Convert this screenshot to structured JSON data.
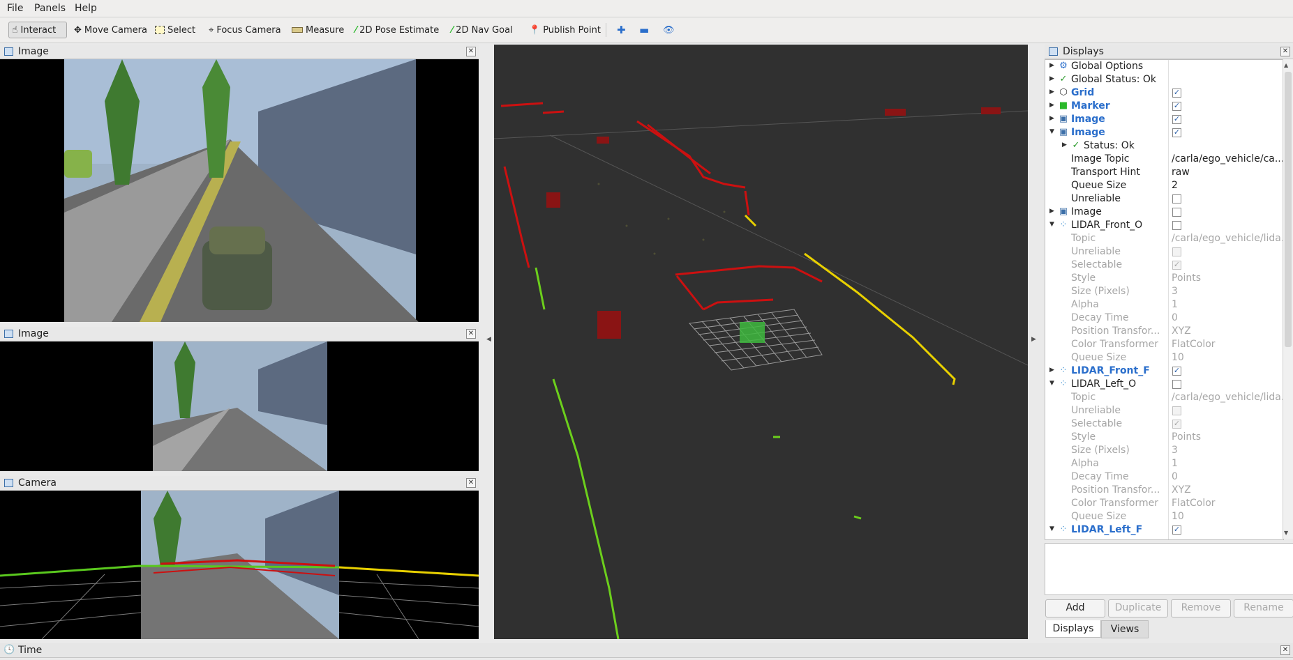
{
  "menu": {
    "file": "File",
    "panels": "Panels",
    "help": "Help"
  },
  "toolbar": {
    "interact": "Interact",
    "move_camera": "Move Camera",
    "select": "Select",
    "focus_camera": "Focus Camera",
    "measure": "Measure",
    "pose_estimate": "2D Pose Estimate",
    "nav_goal": "2D Nav Goal",
    "publish_point": "Publish Point"
  },
  "panels": {
    "image1_title": "Image",
    "image2_title": "Image",
    "camera_title": "Camera",
    "displays_title": "Displays",
    "time_title": "Time"
  },
  "tree": [
    {
      "arrow": "right",
      "icon": "globe-icon",
      "name": "Global Options",
      "value": "",
      "check": null,
      "level": 0,
      "style": "normal"
    },
    {
      "arrow": "right",
      "icon": "check-icon",
      "name": "Global Status: Ok",
      "value": "",
      "check": null,
      "level": 0,
      "style": "normal"
    },
    {
      "arrow": "right",
      "icon": "grid-icon",
      "name": "Grid",
      "value": "",
      "check": true,
      "level": 0,
      "style": "blue"
    },
    {
      "arrow": "right",
      "icon": "cube-icon",
      "name": "Marker",
      "value": "",
      "check": true,
      "level": 0,
      "style": "blue"
    },
    {
      "arrow": "right",
      "icon": "image-icon",
      "name": "Image",
      "value": "",
      "check": true,
      "level": 0,
      "style": "blue"
    },
    {
      "arrow": "down",
      "icon": "image-icon",
      "name": "Image",
      "value": "",
      "check": true,
      "level": 0,
      "style": "blue"
    },
    {
      "arrow": "right",
      "icon": "check-icon",
      "name": "Status: Ok",
      "value": "",
      "check": null,
      "level": 1,
      "style": "normal"
    },
    {
      "arrow": "",
      "icon": "",
      "name": "Image Topic",
      "value": "/carla/ego_vehicle/ca...",
      "check": null,
      "level": 1,
      "style": "normal"
    },
    {
      "arrow": "",
      "icon": "",
      "name": "Transport Hint",
      "value": "raw",
      "check": null,
      "level": 1,
      "style": "normal"
    },
    {
      "arrow": "",
      "icon": "",
      "name": "Queue Size",
      "value": "2",
      "check": null,
      "level": 1,
      "style": "normal"
    },
    {
      "arrow": "",
      "icon": "",
      "name": "Unreliable",
      "value": "",
      "check": false,
      "level": 1,
      "style": "normal"
    },
    {
      "arrow": "right",
      "icon": "image-icon",
      "name": "Image",
      "value": "",
      "check": false,
      "level": 0,
      "style": "normal"
    },
    {
      "arrow": "down",
      "icon": "pointcloud-icon",
      "name": "LIDAR_Front_O",
      "value": "",
      "check": false,
      "level": 0,
      "style": "normal"
    },
    {
      "arrow": "",
      "icon": "",
      "name": "Topic",
      "value": "/carla/ego_vehicle/lida...",
      "check": null,
      "level": 1,
      "style": "dis"
    },
    {
      "arrow": "",
      "icon": "",
      "name": "Unreliable",
      "value": "",
      "check": false,
      "level": 1,
      "style": "dis"
    },
    {
      "arrow": "",
      "icon": "",
      "name": "Selectable",
      "value": "",
      "check": true,
      "level": 1,
      "style": "dis"
    },
    {
      "arrow": "",
      "icon": "",
      "name": "Style",
      "value": "Points",
      "check": null,
      "level": 1,
      "style": "dis"
    },
    {
      "arrow": "",
      "icon": "",
      "name": "Size (Pixels)",
      "value": "3",
      "check": null,
      "level": 1,
      "style": "dis"
    },
    {
      "arrow": "",
      "icon": "",
      "name": "Alpha",
      "value": "1",
      "check": null,
      "level": 1,
      "style": "dis"
    },
    {
      "arrow": "",
      "icon": "",
      "name": "Decay Time",
      "value": "0",
      "check": null,
      "level": 1,
      "style": "dis"
    },
    {
      "arrow": "",
      "icon": "",
      "name": "Position Transfor...",
      "value": "XYZ",
      "check": null,
      "level": 1,
      "style": "dis"
    },
    {
      "arrow": "",
      "icon": "",
      "name": "Color Transformer",
      "value": "FlatColor",
      "check": null,
      "level": 1,
      "style": "dis"
    },
    {
      "arrow": "",
      "icon": "",
      "name": "Queue Size",
      "value": "10",
      "check": null,
      "level": 1,
      "style": "dis"
    },
    {
      "arrow": "right",
      "icon": "pointcloud-icon",
      "name": "LIDAR_Front_F",
      "value": "",
      "check": true,
      "level": 0,
      "style": "blue"
    },
    {
      "arrow": "down",
      "icon": "pointcloud-icon",
      "name": "LIDAR_Left_O",
      "value": "",
      "check": false,
      "level": 0,
      "style": "normal"
    },
    {
      "arrow": "",
      "icon": "",
      "name": "Topic",
      "value": "/carla/ego_vehicle/lida...",
      "check": null,
      "level": 1,
      "style": "dis"
    },
    {
      "arrow": "",
      "icon": "",
      "name": "Unreliable",
      "value": "",
      "check": false,
      "level": 1,
      "style": "dis"
    },
    {
      "arrow": "",
      "icon": "",
      "name": "Selectable",
      "value": "",
      "check": true,
      "level": 1,
      "style": "dis"
    },
    {
      "arrow": "",
      "icon": "",
      "name": "Style",
      "value": "Points",
      "check": null,
      "level": 1,
      "style": "dis"
    },
    {
      "arrow": "",
      "icon": "",
      "name": "Size (Pixels)",
      "value": "3",
      "check": null,
      "level": 1,
      "style": "dis"
    },
    {
      "arrow": "",
      "icon": "",
      "name": "Alpha",
      "value": "1",
      "check": null,
      "level": 1,
      "style": "dis"
    },
    {
      "arrow": "",
      "icon": "",
      "name": "Decay Time",
      "value": "0",
      "check": null,
      "level": 1,
      "style": "dis"
    },
    {
      "arrow": "",
      "icon": "",
      "name": "Position Transfor...",
      "value": "XYZ",
      "check": null,
      "level": 1,
      "style": "dis"
    },
    {
      "arrow": "",
      "icon": "",
      "name": "Color Transformer",
      "value": "FlatColor",
      "check": null,
      "level": 1,
      "style": "dis"
    },
    {
      "arrow": "",
      "icon": "",
      "name": "Queue Size",
      "value": "10",
      "check": null,
      "level": 1,
      "style": "dis"
    },
    {
      "arrow": "down",
      "icon": "pointcloud-icon",
      "name": "LIDAR_Left_F",
      "value": "",
      "check": true,
      "level": 0,
      "style": "blue"
    }
  ],
  "buttons": {
    "add": "Add",
    "duplicate": "Duplicate",
    "remove": "Remove",
    "rename": "Rename"
  },
  "tabs": {
    "displays": "Displays",
    "views": "Views"
  },
  "colors": {
    "viewport_bg": "#303030",
    "selected_blue": "#2a6ecb",
    "lidar_red": "#cc1010",
    "lidar_yellow": "#e8d000",
    "lidar_green": "#6ccf1c"
  }
}
